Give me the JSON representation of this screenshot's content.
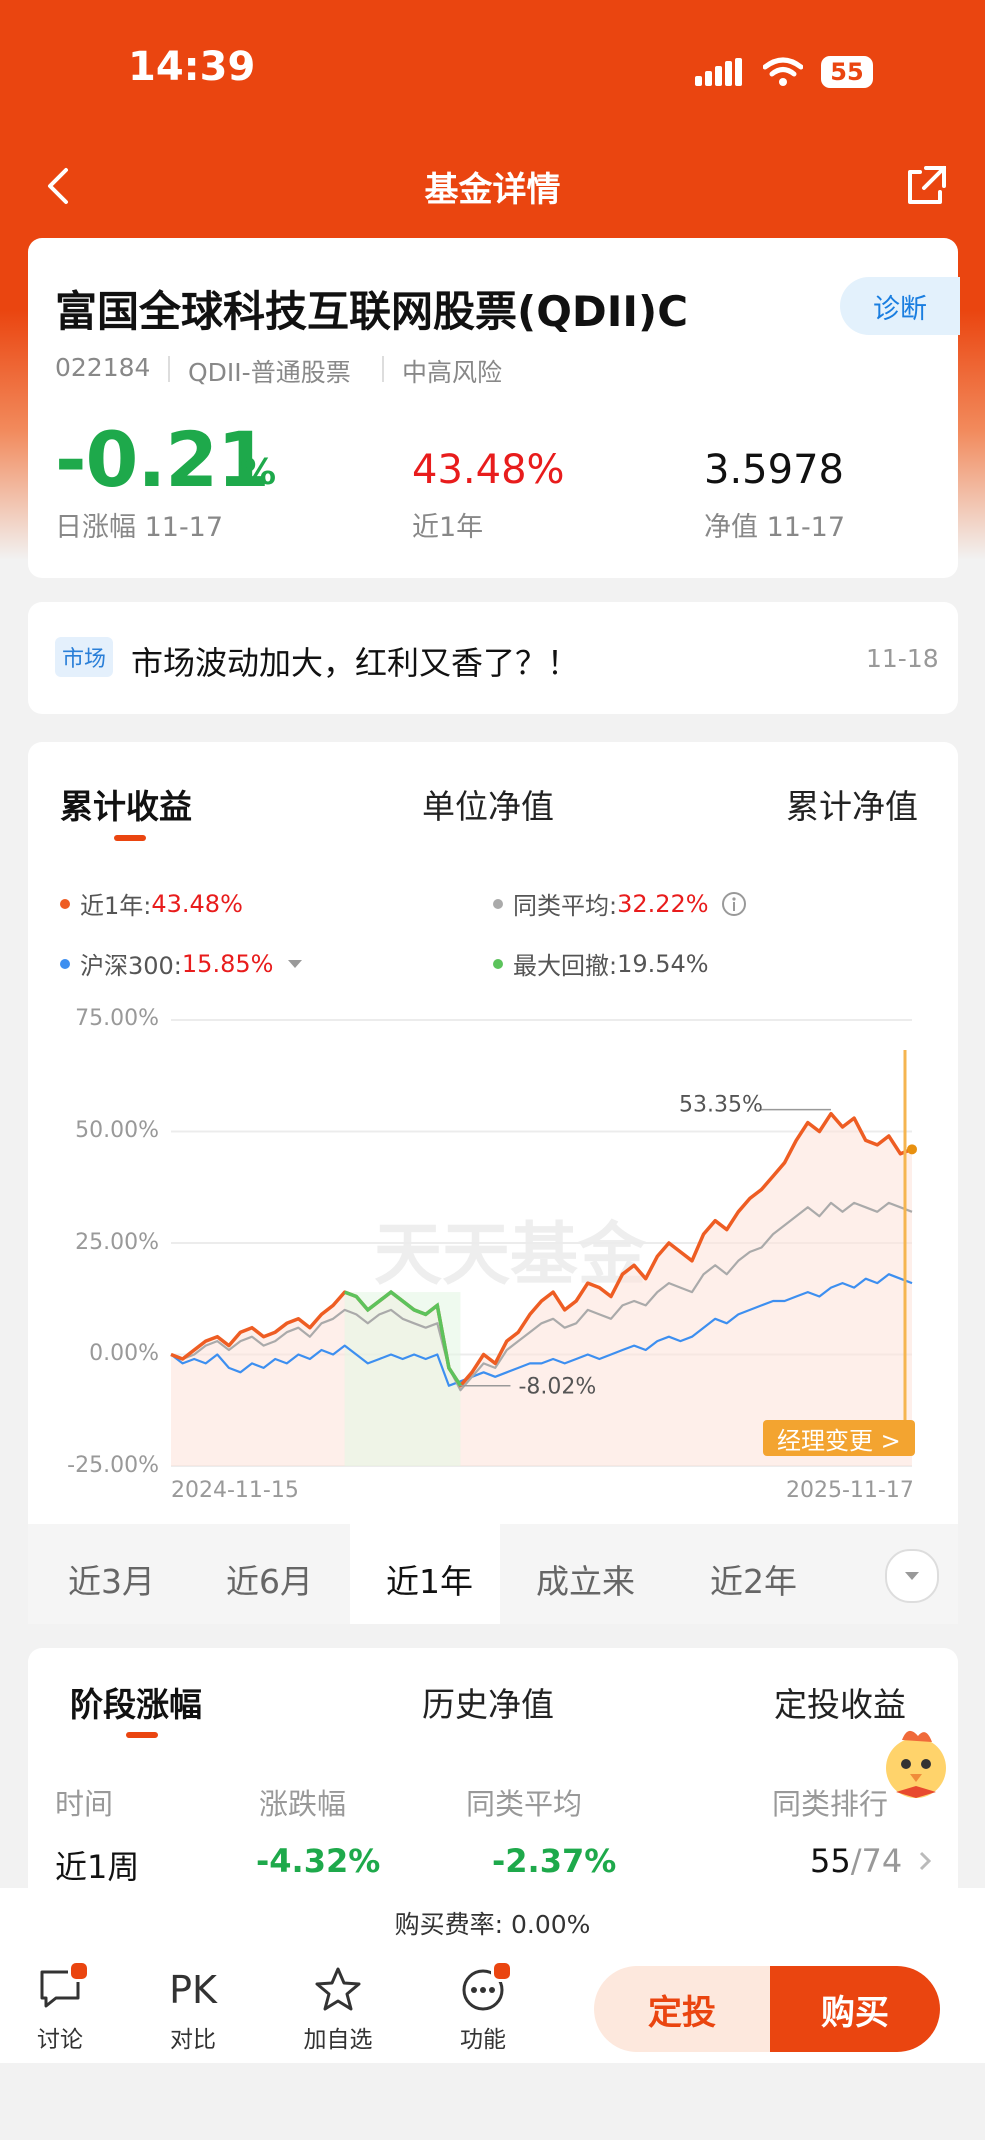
{
  "status_bar": {
    "time": "14:39",
    "battery": "55"
  },
  "nav": {
    "title": "基金详情"
  },
  "fund": {
    "name": "富国全球科技互联网股票(QDII)C",
    "diagnose_label": "诊断",
    "code": "022184",
    "type": "QDII-普通股票",
    "risk": "中高风险",
    "daily_change": "-0.21",
    "daily_change_unit": "%",
    "daily_change_label": "日涨幅 11-17",
    "one_year_return": "43.48%",
    "one_year_label": "近1年",
    "nav_value": "3.5978",
    "nav_label": "净值 11-17"
  },
  "news": {
    "tag": "市场",
    "text": "市场波动加大，红利又香了？！",
    "date": "11-18"
  },
  "chart_tabs": [
    "累计收益",
    "单位净值",
    "累计净值"
  ],
  "legend": {
    "near_1y_label": "近1年:",
    "near_1y_value": "43.48%",
    "peer_avg_label": "同类平均:",
    "peer_avg_value": "32.22%",
    "hs300_label": "沪深300:",
    "hs300_value": "15.85%",
    "max_dd_label": "最大回撤:",
    "max_dd_value": "19.54%"
  },
  "chart_annotations": {
    "peak": "53.35%",
    "trough": "-8.02%",
    "watermark": "天天基金",
    "manager_change": "经理变更 >"
  },
  "chart_data": {
    "type": "line",
    "x_start": "2024-11-15",
    "x_end": "2025-11-17",
    "ylim": [
      -25,
      75
    ],
    "yticks": [
      "75.00%",
      "50.00%",
      "25.00%",
      "0.00%",
      "-25.00%"
    ],
    "series": [
      {
        "name": "近1年",
        "color": "#ee5d23",
        "values": [
          0,
          -1,
          1,
          3,
          4,
          2,
          5,
          6,
          4,
          5,
          7,
          8,
          6,
          9,
          11,
          14,
          13,
          10,
          12,
          14,
          12,
          10,
          9,
          11,
          -3,
          -7,
          -4,
          0,
          -2,
          3,
          5,
          9,
          12,
          14,
          10,
          12,
          16,
          15,
          13,
          18,
          20,
          17,
          22,
          25,
          23,
          21,
          27,
          30,
          28,
          32,
          35,
          37,
          40,
          43,
          48,
          52,
          50,
          54,
          51,
          53,
          48,
          47,
          49,
          45,
          46
        ]
      },
      {
        "name": "同类平均",
        "color": "#aaaaaa",
        "values": [
          0,
          -1,
          0,
          2,
          3,
          1,
          3,
          4,
          2,
          3,
          5,
          6,
          4,
          7,
          8,
          10,
          9,
          7,
          9,
          10,
          8,
          7,
          6,
          7,
          -3,
          -8,
          -5,
          -2,
          -3,
          1,
          3,
          5,
          7,
          8,
          6,
          7,
          10,
          9,
          8,
          11,
          12,
          11,
          14,
          16,
          15,
          14,
          18,
          20,
          18,
          21,
          23,
          24,
          27,
          29,
          31,
          33,
          31,
          34,
          32,
          34,
          33,
          32,
          34,
          33,
          32
        ]
      },
      {
        "name": "沪深300",
        "color": "#3d8ff0",
        "values": [
          0,
          -2,
          -1,
          -2,
          0,
          -3,
          -4,
          -2,
          -3,
          -1,
          -2,
          0,
          -1,
          1,
          0,
          2,
          0,
          -2,
          -1,
          0,
          -1,
          0,
          -1,
          0,
          -7,
          -6,
          -5,
          -4,
          -5,
          -4,
          -3,
          -2,
          -2,
          -1,
          -2,
          -1,
          0,
          -1,
          0,
          1,
          2,
          1,
          3,
          4,
          3,
          4,
          6,
          8,
          7,
          9,
          10,
          11,
          12,
          12,
          13,
          14,
          13,
          15,
          16,
          15,
          17,
          16,
          18,
          17,
          16
        ]
      }
    ]
  },
  "periods": [
    "近3月",
    "近6月",
    "近1年",
    "成立来",
    "近2年"
  ],
  "bottom_tabs": [
    "阶段涨幅",
    "历史净值",
    "定投收益"
  ],
  "table": {
    "headers": [
      "时间",
      "涨跌幅",
      "同类平均",
      "同类排行"
    ],
    "rows": [
      {
        "period": "近1周",
        "change": "-4.32%",
        "peer_avg": "-2.37%",
        "rank": "55",
        "rank_total": "/74"
      }
    ]
  },
  "fee": "购买费率: 0.00%",
  "bottom_bar": {
    "items": [
      "讨论",
      "对比",
      "加自选",
      "功能"
    ],
    "pk_text": "PK",
    "dingtou": "定投",
    "buy": "购买"
  }
}
